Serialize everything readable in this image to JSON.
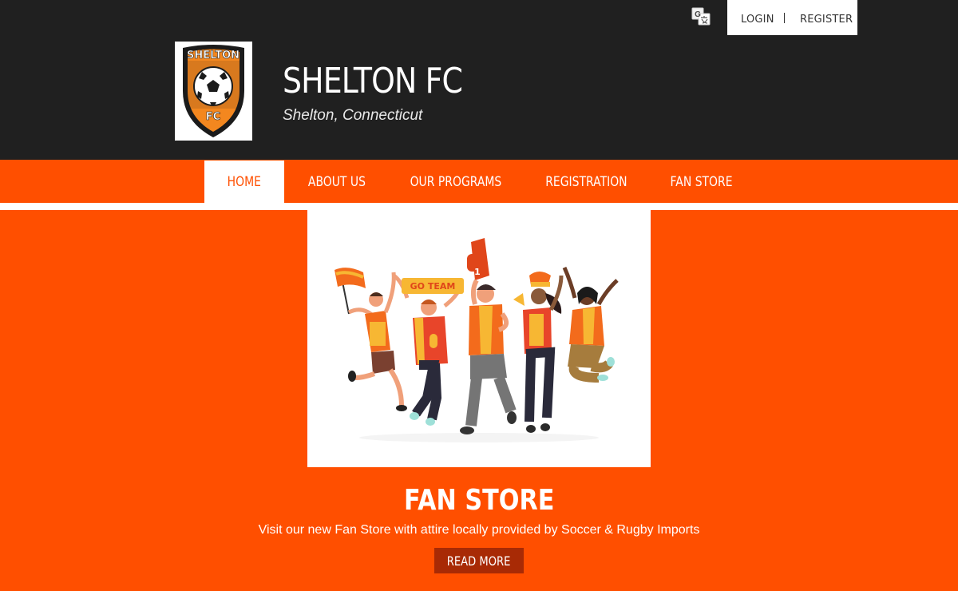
{
  "header": {
    "club_name": "SHELTON FC",
    "location": "Shelton, Connecticut",
    "logo_text_top": "SHELTON",
    "logo_text_bottom": "FC",
    "translate_icon": "google-translate-icon",
    "login_label": "LOGIN",
    "register_label": "REGISTER"
  },
  "nav": {
    "items": [
      {
        "label": "HOME",
        "active": true
      },
      {
        "label": "ABOUT US"
      },
      {
        "label": "OUR PROGRAMS"
      },
      {
        "label": "REGISTRATION"
      },
      {
        "label": "FAN STORE"
      }
    ]
  },
  "hero": {
    "banner_text": "GO TEAM",
    "foam_finger_number": "1",
    "title": "FAN STORE",
    "description": "Visit our new Fan Store with attire locally provided by Soccer & Rugby Imports",
    "button_label": "READ MORE"
  },
  "colors": {
    "brand_orange": "#ff4f00",
    "header_dark": "#202020",
    "button_dark": "#a82a05"
  }
}
